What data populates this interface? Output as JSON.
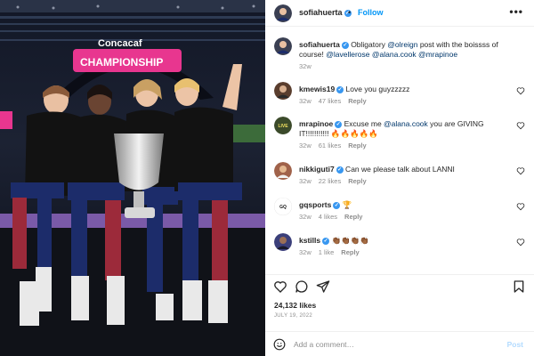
{
  "post": {
    "username": "sofiahuerta",
    "follow_label": "Follow",
    "dot": "•",
    "more_label": "•••",
    "caption_user": "sofiahuerta",
    "caption_text_1": " Obligatory ",
    "caption_mention_1": "@olreign",
    "caption_text_2": " post with the boissss of course! ",
    "caption_mention_2": "@lavellerose",
    "caption_mention_3": "@alana.cook",
    "caption_mention_4": "@mrapinoe",
    "caption_time": "32w",
    "likes": "24,132 likes",
    "date": "JULY 19, 2022"
  },
  "photo": {
    "banner_brand": "Concacaf",
    "banner_title": "CHAMPIONSHIP"
  },
  "comments": [
    {
      "user": "kmewis19",
      "text": " Love you guyzzzzz",
      "time": "32w",
      "likes": "47 likes",
      "reply": "Reply"
    },
    {
      "user": "mrapinoe",
      "text_1": " Excuse me ",
      "mention": "@alana.cook",
      "text_2": " you are GIVING IT!!!!!!!!!!! 🔥🔥🔥🔥🔥",
      "time": "32w",
      "likes": "61 likes",
      "reply": "Reply"
    },
    {
      "user": "nikkiguti7",
      "text": " Can we please talk about LANNI",
      "time": "32w",
      "likes": "22 likes",
      "reply": "Reply"
    },
    {
      "user": "gqsports",
      "text": " 🏆",
      "time": "32w",
      "likes": "4 likes",
      "reply": "Reply"
    },
    {
      "user": "kstills",
      "text": " 👏🏾👏🏾👏🏾👏🏾",
      "time": "32w",
      "likes": "1 like",
      "reply": "Reply"
    }
  ],
  "add_comment": {
    "placeholder": "Add a comment…",
    "post_label": "Post"
  },
  "colors": {
    "accent": "#0095f6",
    "verified": "#3897f0",
    "banner_pink": "#e8368f",
    "mention": "#00376b"
  },
  "icons": [
    "verified-badge-icon",
    "more-options-icon",
    "heart-icon",
    "comment-icon",
    "share-icon",
    "bookmark-icon",
    "emoji-icon"
  ]
}
